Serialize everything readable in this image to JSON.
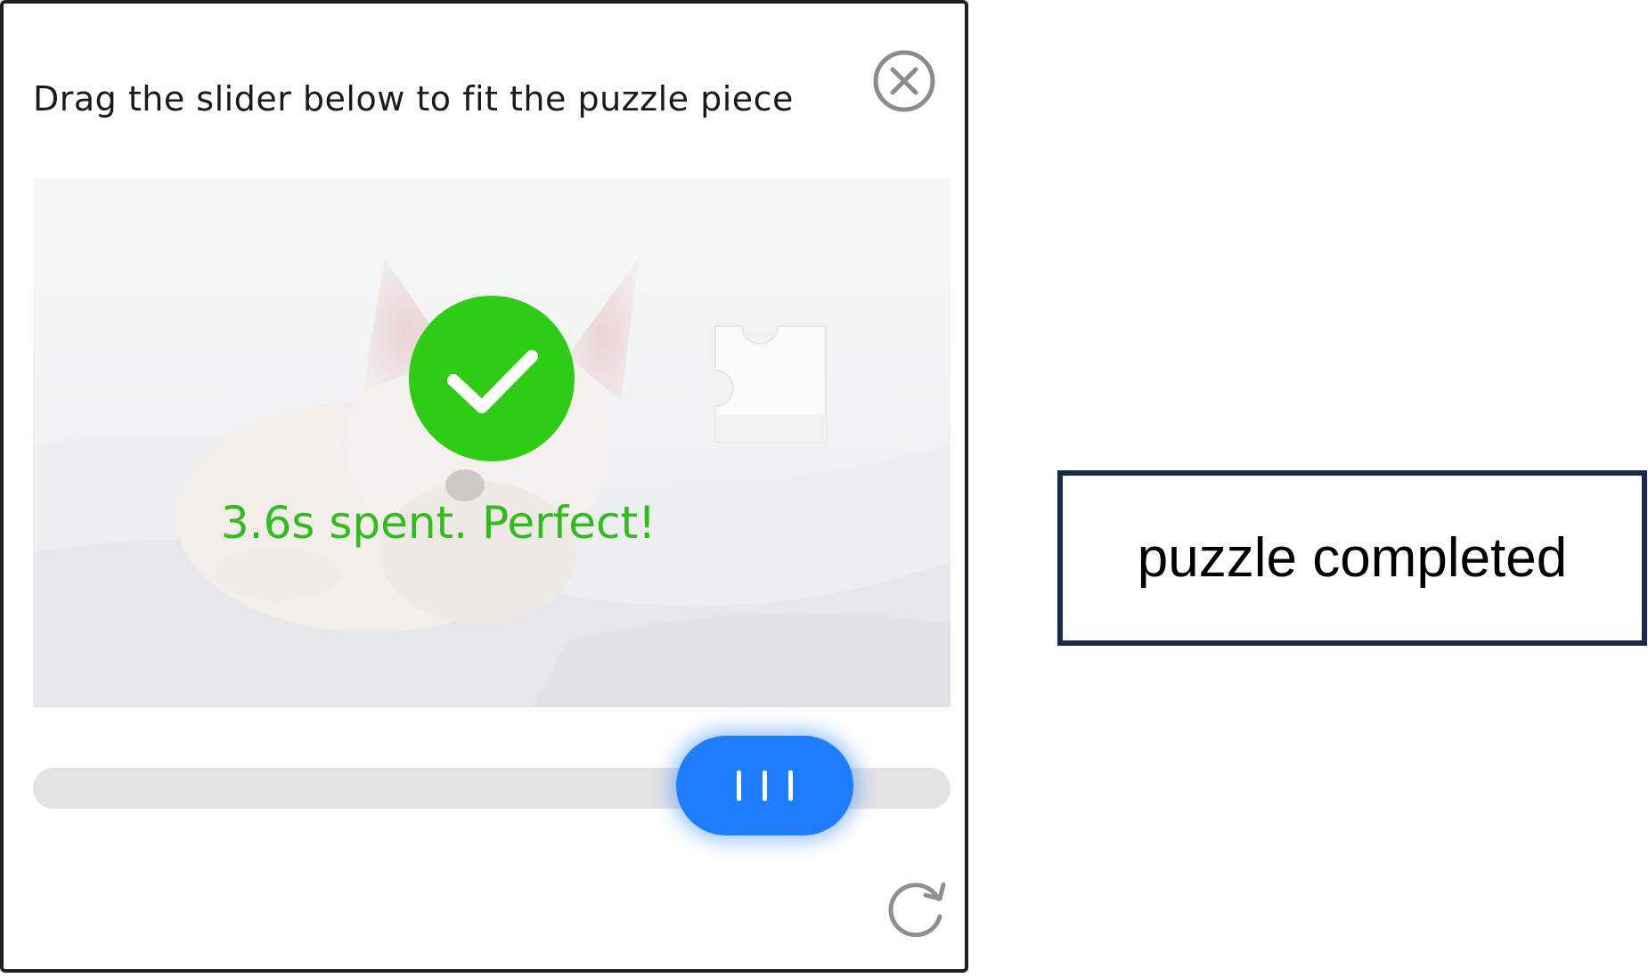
{
  "dialog": {
    "prompt": "Drag the slider below to fit the puzzle piece",
    "close_icon": "close-circle-icon",
    "success_icon": "check-circle-icon",
    "success_text": "3.6s spent. Perfect!",
    "refresh_icon": "refresh-icon",
    "colors": {
      "success": "#2fbd1c",
      "slider_handle": "#1e7dff",
      "slider_track": "#e3e3e3"
    }
  },
  "callout": {
    "label": "puzzle completed",
    "border_color": "#1b2a49"
  }
}
